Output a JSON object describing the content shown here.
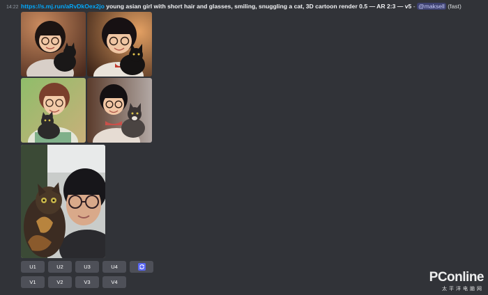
{
  "message": {
    "timestamp": "14:22",
    "link": "https://s.mj.run/aRvDkOex2jo",
    "prompt": "young asian girl with short hair and glasses, smiling, snuggling a cat, 3D cartoon render 0.5 — AR 2:3 — v5",
    "separator": " - ",
    "mention": "@maksell",
    "speed": "(fast)"
  },
  "grid": {
    "images": [
      {
        "name": "grid-image-1",
        "alt": "cartoon girl with black cat"
      },
      {
        "name": "grid-image-2",
        "alt": "cartoon girl with black cat"
      },
      {
        "name": "grid-image-3",
        "alt": "cartoon girl with cat"
      },
      {
        "name": "grid-image-4",
        "alt": "cartoon girl with cat"
      }
    ]
  },
  "reference_photo": {
    "alt": "woman with glasses holding a tortoiseshell cat"
  },
  "buttons": {
    "upscale": [
      "U1",
      "U2",
      "U3",
      "U4"
    ],
    "variation": [
      "V1",
      "V2",
      "V3",
      "V4"
    ],
    "reroll_icon": "refresh-icon"
  },
  "watermark": {
    "brand": "PConline",
    "sub": "太平洋电脑网"
  },
  "colors": {
    "background": "#313338",
    "link": "#00a8fc",
    "button": "#4e5058",
    "reroll_accent": "#5865f2"
  }
}
